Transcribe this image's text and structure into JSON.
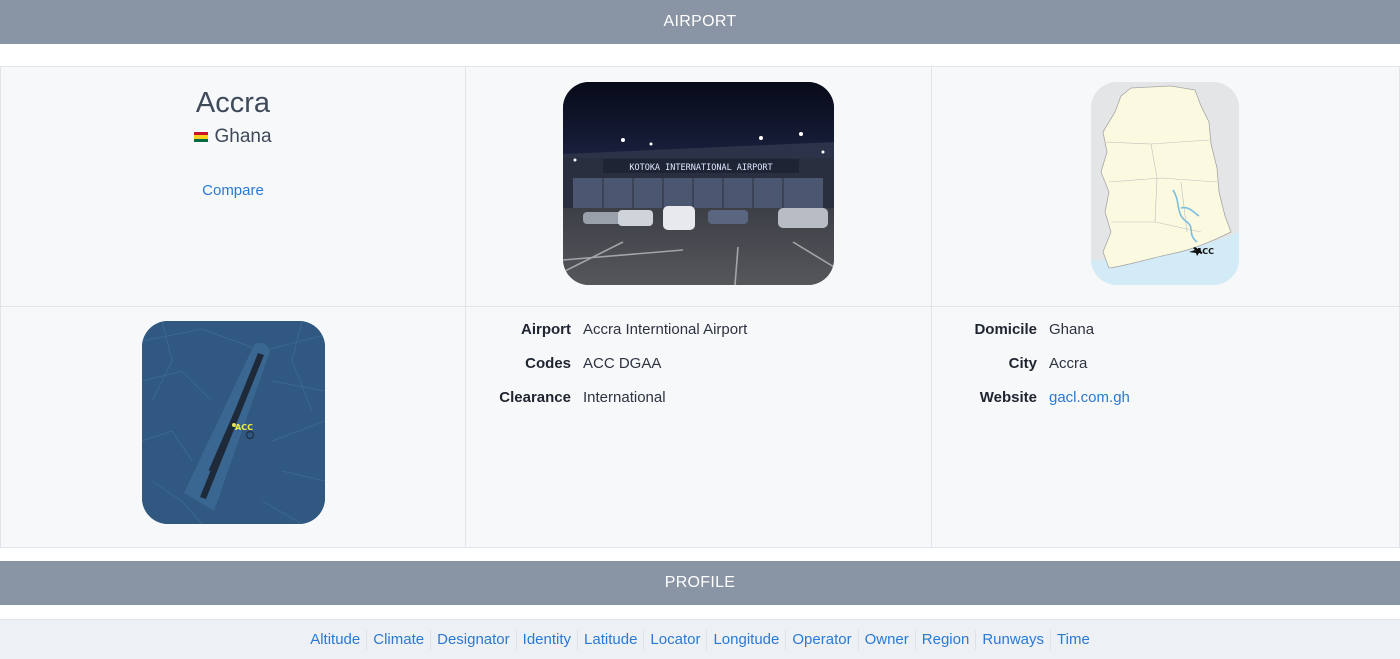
{
  "sections": {
    "airport": "AIRPORT",
    "profile": "PROFILE"
  },
  "summary": {
    "city": "Accra",
    "country": "Ghana",
    "compare_label": "Compare"
  },
  "photo": {
    "sign_text": "KOTOKA INTERNATIONAL AIRPORT"
  },
  "map": {
    "marker_label": "ACC"
  },
  "runway_map": {
    "marker_label": "ACC"
  },
  "details": [
    {
      "key": "Airport",
      "value": "Accra Interntional Airport"
    },
    {
      "key": "Codes",
      "value": "ACC DGAA"
    },
    {
      "key": "Clearance",
      "value": "International"
    }
  ],
  "location": [
    {
      "key": "Domicile",
      "value": "Ghana"
    },
    {
      "key": "City",
      "value": "Accra"
    },
    {
      "key": "Website",
      "value": "gacl.com.gh"
    }
  ],
  "profile_links": [
    "Altitude",
    "Climate",
    "Designator",
    "Identity",
    "Latitude",
    "Locator",
    "Longitude",
    "Operator",
    "Owner",
    "Region",
    "Runways",
    "Time"
  ],
  "colors": {
    "header_bg": "#8994a4",
    "link": "#2a79d4",
    "flag_red": "#ce1126",
    "flag_gold": "#fcd116",
    "flag_green": "#006b3f"
  }
}
